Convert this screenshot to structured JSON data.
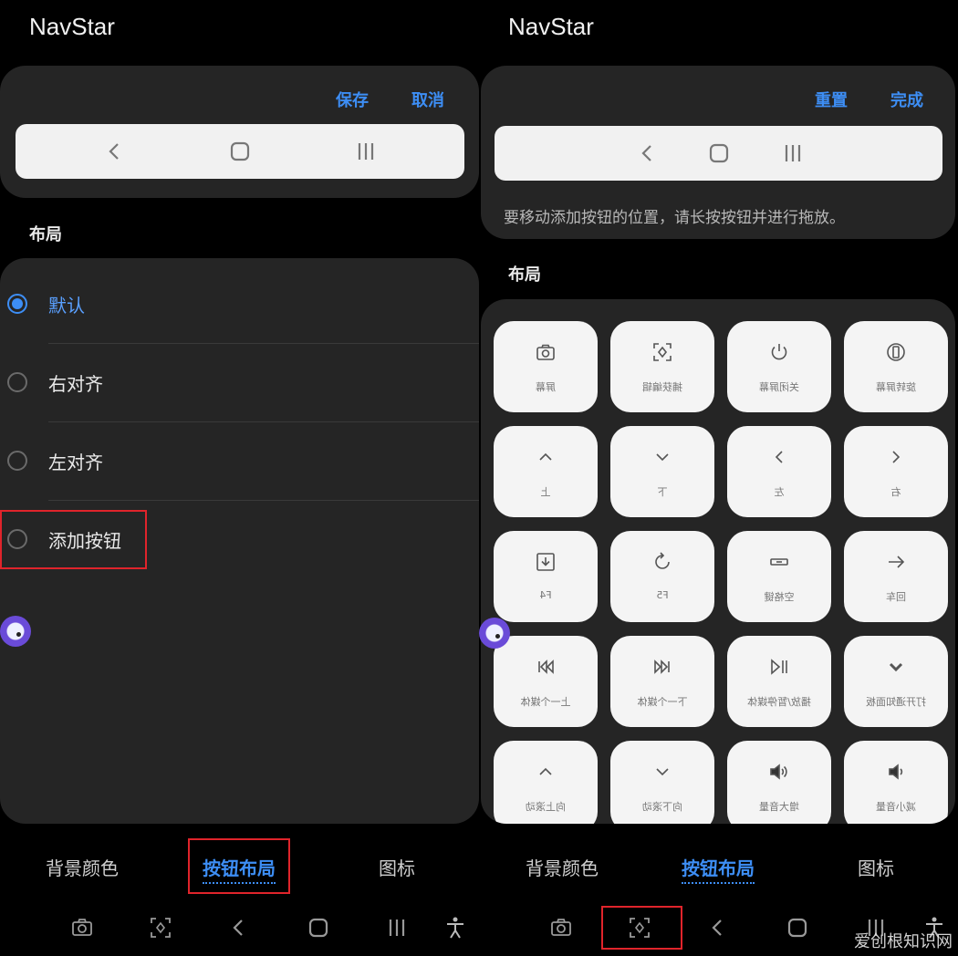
{
  "left": {
    "app_title": "NavStar",
    "actions": {
      "save": "保存",
      "cancel": "取消"
    },
    "section_label": "布局",
    "radio_options": [
      {
        "label": "默认",
        "selected": true
      },
      {
        "label": "右对齐",
        "selected": false
      },
      {
        "label": "左对齐",
        "selected": false
      },
      {
        "label": "添加按钮",
        "selected": false
      }
    ],
    "tabs": [
      {
        "label": "背景颜色",
        "active": false
      },
      {
        "label": "按钮布局",
        "active": true
      },
      {
        "label": "图标",
        "active": false
      }
    ]
  },
  "right": {
    "app_title": "NavStar",
    "actions": {
      "reset": "重置",
      "done": "完成"
    },
    "hint": "要移动添加按钮的位置，请长按按钮并进行拖放。",
    "section_label": "布局",
    "buttons": [
      {
        "label": "屏幕",
        "icon": "camera-icon"
      },
      {
        "label": "捕获编辑",
        "icon": "capture-icon"
      },
      {
        "label": "关闭屏幕",
        "icon": "power-icon"
      },
      {
        "label": "旋转屏幕",
        "icon": "rotate-screen-icon"
      },
      {
        "label": "上",
        "icon": "chevron-up-icon"
      },
      {
        "label": "下",
        "icon": "chevron-down-icon"
      },
      {
        "label": "左",
        "icon": "chevron-left-icon"
      },
      {
        "label": "右",
        "icon": "chevron-right-icon"
      },
      {
        "label": "F4",
        "icon": "download-box-icon"
      },
      {
        "label": "F5",
        "icon": "refresh-icon"
      },
      {
        "label": "空格键",
        "icon": "space-key-icon"
      },
      {
        "label": "回车",
        "icon": "arrow-right-icon"
      },
      {
        "label": "上一个媒体",
        "icon": "skip-previous-icon"
      },
      {
        "label": "下一个媒体",
        "icon": "skip-next-icon"
      },
      {
        "label": "播放/暂停媒体",
        "icon": "play-pause-icon"
      },
      {
        "label": "打开通知面板",
        "icon": "chevron-down-bold-icon"
      },
      {
        "label": "向上滚动",
        "icon": "chevron-up-icon"
      },
      {
        "label": "向下滚动",
        "icon": "chevron-down-icon"
      },
      {
        "label": "增大音量",
        "icon": "volume-up-icon"
      },
      {
        "label": "减小音量",
        "icon": "volume-down-icon"
      }
    ],
    "tabs": [
      {
        "label": "背景颜色",
        "active": false
      },
      {
        "label": "按钮布局",
        "active": true
      },
      {
        "label": "图标",
        "active": false
      }
    ]
  },
  "watermark": "爱创根知识网",
  "colors": {
    "accent": "#3d8ef5",
    "card": "#252525",
    "highlight": "#e0242b"
  }
}
